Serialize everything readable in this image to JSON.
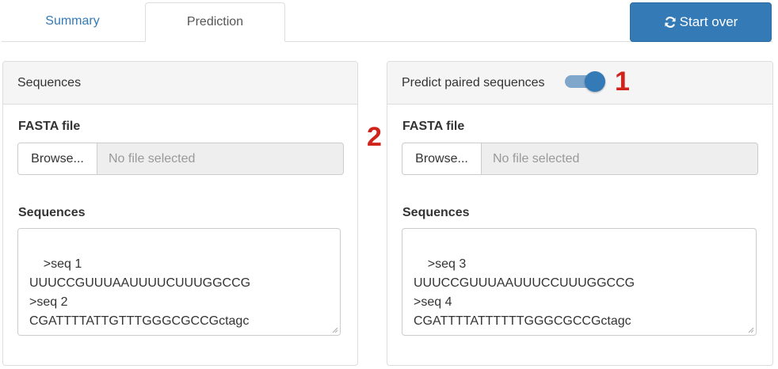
{
  "tabs": {
    "summary_label": "Summary",
    "prediction_label": "Prediction"
  },
  "start_over": {
    "label": "Start over",
    "icon": "refresh-icon"
  },
  "left_panel": {
    "title": "Sequences",
    "fasta_label": "FASTA file",
    "browse_label": "Browse...",
    "file_placeholder": "No file selected",
    "sequences_label": "Sequences",
    "sequences_value": ">seq 1\nUUUCCGUUUAAUUUUCUUUGGCCG\n>seq 2\nCGATTTTATTGTTTGGGCGCCGctagc"
  },
  "right_panel": {
    "toggle_label": "Predict paired sequences",
    "toggle_on": true,
    "fasta_label": "FASTA file",
    "browse_label": "Browse...",
    "file_placeholder": "No file selected",
    "sequences_label": "Sequences",
    "sequences_value": ">seq 3\nUUUCCGUUUAAUUUCCUUUGGCCG\n>seq 4\nCGATTTTATTTTTTGGGCGCCGctagc"
  },
  "annotations": {
    "marker_1": "1",
    "marker_2": "2"
  },
  "colors": {
    "primary": "#337ab7",
    "annotation": "#d0231c",
    "panel_heading_bg": "#f5f5f5",
    "disabled_input_bg": "#eeeeee"
  }
}
